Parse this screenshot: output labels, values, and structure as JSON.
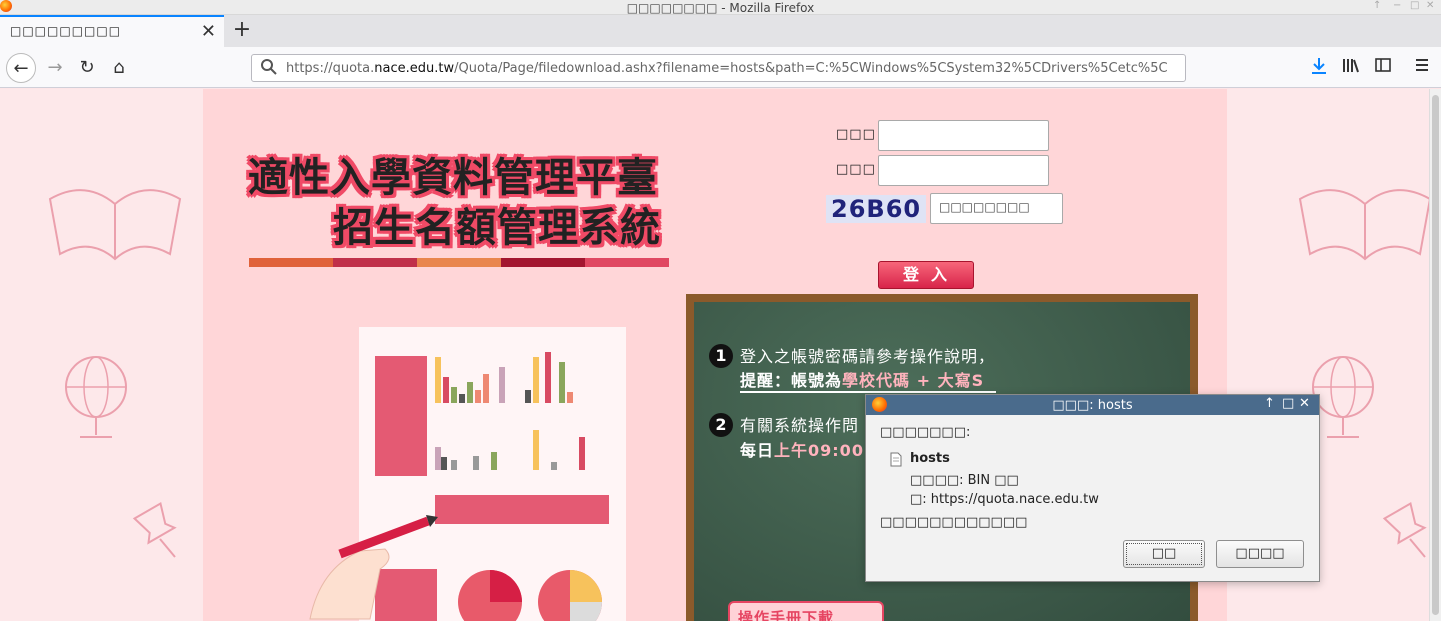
{
  "window": {
    "title": "□□□□□□□□ - Mozilla Firefox",
    "controls": [
      "↑",
      "−",
      "□",
      "✕"
    ]
  },
  "tab": {
    "title": "□□□□□□□□□",
    "close": "✕",
    "new_tab": "+"
  },
  "nav": {
    "back": "←",
    "forward": "→",
    "reload": "↻",
    "home": "⌂",
    "url_prefix": "https://quota.",
    "url_domain": "nace.edu.tw",
    "url_rest": "/Quota/Page/filedownload.ashx?filename=hosts&path=C:%5CWindows%5CSystem32%5CDrivers%5Cetc%5C",
    "toolbar_icons": [
      "download-icon",
      "library-icon",
      "sidebar-icon",
      "menu-icon"
    ]
  },
  "site": {
    "title_line1": "適性入學資料管理平臺",
    "title_line2": "招生名額管理系統",
    "stripe_colors": [
      "#e0623a",
      "#c0304a",
      "#e9864e",
      "#a31630",
      "#e04862"
    ]
  },
  "login": {
    "username_label": "□□□",
    "password_label": "□□□",
    "captcha_text": "26B60",
    "captcha_placeholder": "□□□□□□□□",
    "login_button": "登入"
  },
  "board": {
    "item1_num": "1",
    "item1_line1": "登入之帳號密碼請參考操作說明，",
    "item1_line2_prefix": "提醒：帳號為",
    "item1_line2_highlight": "學校代碼 + 大寫S",
    "item2_num": "2",
    "item2_line1": "有關系統操作問",
    "item2_line2_prefix": "每日",
    "item2_line2_highlight": "上午09:00",
    "manual_button": "操作手冊下載"
  },
  "dialog": {
    "title": "□□□: hosts",
    "controls": [
      "↑",
      "□",
      "✕"
    ],
    "intro": "□□□□□□□:",
    "filename": "hosts",
    "type_line": "□□□□: BIN □□",
    "from_line": "□: https://quota.nace.edu.tw",
    "question": "□□□□□□□□□□□□",
    "ok_button": "□□",
    "cancel_button": "□□□□"
  }
}
